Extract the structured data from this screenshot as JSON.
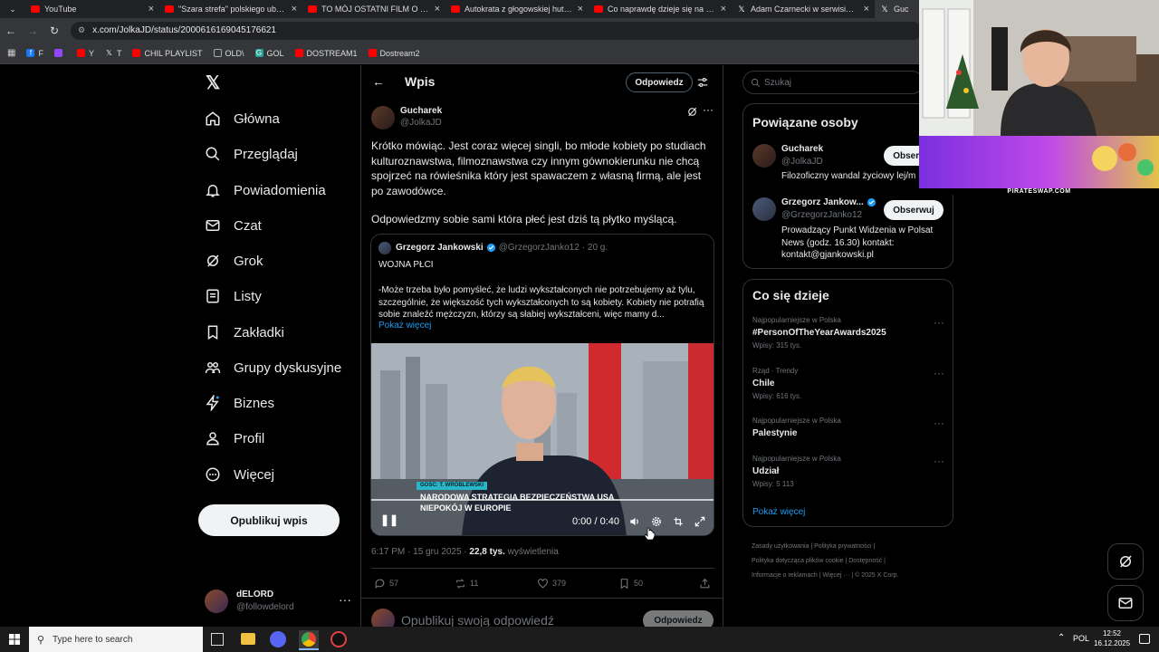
{
  "browser": {
    "tabs": [
      {
        "title": "YouTube",
        "icon": "youtube-icon"
      },
      {
        "title": "\"Szara strefa\" polskiego ubóstwa",
        "icon": "youtube-icon"
      },
      {
        "title": "TO MÓJ OSTATNI FILM O FAZIE",
        "icon": "youtube-icon"
      },
      {
        "title": "Autokrata z głogowskiej huty w",
        "icon": "youtube-icon"
      },
      {
        "title": "Co naprawdę dzieje się na uzb",
        "icon": "youtube-icon"
      },
      {
        "title": "Adam Czarnecki w serwisie X: „",
        "icon": "x-icon"
      },
      {
        "title": "Guc",
        "icon": "x-icon"
      }
    ],
    "url": "x.com/JolkaJD/status/2000616169045176621",
    "bookmarks": [
      {
        "label": "F",
        "color": "#1877f2"
      },
      {
        "label": "",
        "color": "#9146ff"
      },
      {
        "label": "Y",
        "color": "#ff0000"
      },
      {
        "label": "T",
        "color": "#ffffff"
      },
      {
        "label": "CHIL PLAYLIST",
        "color": "#ff0000"
      },
      {
        "label": "OLD\\",
        "color": "#aaaaaa"
      },
      {
        "label": "GOL",
        "color": "#2aa198"
      },
      {
        "label": "DOSTREAM1",
        "color": "#ff0000"
      },
      {
        "label": "Dostream2",
        "color": "#ff0000"
      }
    ]
  },
  "nav": {
    "items": [
      {
        "label": "Główna",
        "icon": "home-icon"
      },
      {
        "label": "Przeglądaj",
        "icon": "search-icon"
      },
      {
        "label": "Powiadomienia",
        "icon": "bell-icon"
      },
      {
        "label": "Czat",
        "icon": "mail-icon"
      },
      {
        "label": "Grok",
        "icon": "grok-icon"
      },
      {
        "label": "Listy",
        "icon": "list-icon"
      },
      {
        "label": "Zakładki",
        "icon": "bookmark-icon"
      },
      {
        "label": "Grupy dyskusyjne",
        "icon": "communities-icon"
      },
      {
        "label": "Biznes",
        "icon": "lightning-icon"
      },
      {
        "label": "Profil",
        "icon": "person-icon"
      },
      {
        "label": "Więcej",
        "icon": "more-circle-icon"
      }
    ],
    "post_button": "Opublikuj wpis",
    "account": {
      "name": "dELORD",
      "handle": "@followdelord"
    }
  },
  "header": {
    "title": "Wpis",
    "reply_button": "Odpowiedz"
  },
  "tweet": {
    "author_name": "Gucharek",
    "author_handle": "@JolkaJD",
    "text_p1": "Krótko mówiąc. Jest coraz więcej singli, bo młode kobiety po studiach kulturoznawstwa, filmoznawstwa czy innym gównokierunku nie chcą spojrzeć na rówieśnika który jest spawaczem z własną firmą, ale jest po zawodówce.",
    "text_p2": "Odpowiedzmy sobie sami która płeć jest dziś tą płytko myślącą.",
    "timestamp": "6:17 PM · 15 gru 2025",
    "views_count": "22,8 tys.",
    "views_label": "wyświetlenia",
    "replies": "57",
    "reposts": "11",
    "likes": "379",
    "bookmarks": "50"
  },
  "quote": {
    "author_name": "Grzegorz Jankowski",
    "author_handle": "@GrzegorzJanko12",
    "time": "· 20 g.",
    "title": "WOJNA PŁCI",
    "text": "-Może trzeba było pomyśleć, że ludzi wykształconych nie potrzebujemy aż tylu, szczególnie, że większość tych wykształconych to są kobiety. Kobiety nie potrafią sobie znaleźć mężczyzn, którzy są słabiej wykształceni, więc mamy d...",
    "show_more": "Pokaż więcej",
    "video": {
      "guest_label": "GOŚĆ: T. WRÓBLEWSKI",
      "lower_third_1": "NARODOWA STRATEGIA BEZPIECZEŃSTWA USA",
      "lower_third_2": "NIEPOKÓJ W EUROPIE",
      "time": "0:00 / 0:40",
      "progress": 0
    }
  },
  "reply_box": {
    "placeholder": "Opublikuj swoją odpowiedź",
    "button": "Odpowiedz"
  },
  "sidebar": {
    "search_placeholder": "Szukaj",
    "related_title": "Powiązane osoby",
    "related": [
      {
        "name": "Gucharek",
        "handle": "@JolkaJD",
        "bio": "Filozoficzny wandal życiowy lej/m",
        "button": "Obserwuj",
        "verified": false
      },
      {
        "name": "Grzegorz Jankow...",
        "handle": "@GrzegorzJanko12",
        "bio": "Prowadzący Punkt Widzenia w Polsat News (godz. 16.30) kontakt: kontakt@gjankowski.pl",
        "button": "Obserwuj",
        "verified": true
      }
    ],
    "trends_title": "Co się dzieje",
    "trends": [
      {
        "category": "Najpopularniejsze w Polska",
        "title": "#PersonOfTheYearAwards2025",
        "count": "Wpisy: 315 tys."
      },
      {
        "category": "Rząd · Trendy",
        "title": "Chile",
        "count": "Wpisy: 616 tys."
      },
      {
        "category": "Najpopularniejsze w Polska",
        "title": "Palestynie",
        "count": ""
      },
      {
        "category": "Najpopularniejsze w Polska",
        "title": "Udział",
        "count": "Wpisy: 5 113"
      }
    ],
    "show_more": "Pokaż więcej",
    "footer_1": "Zasady użytkowania  |  Polityka prywatności  |",
    "footer_2": "Polityka dotycząca plików cookie  |  Dostępność  |",
    "footer_3": "Informacje o reklamach  |  Więcej ···  |  © 2025 X Corp."
  },
  "webcam": {
    "banner_text": "PIRATESWAP.COM"
  },
  "taskbar": {
    "search_placeholder": "Type here to search",
    "lang": "POL",
    "time": "12:52",
    "date": "16.12.2025"
  },
  "colors": {
    "accent": "#1d9bf0",
    "bg": "#000000",
    "border": "#2f3336",
    "muted": "#71767b"
  }
}
